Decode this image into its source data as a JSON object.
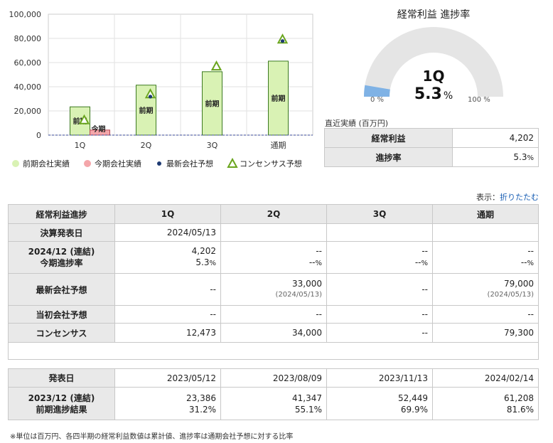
{
  "chart_data": {
    "type": "bar",
    "categories": [
      "1Q",
      "2Q",
      "3Q",
      "通期"
    ],
    "ylim": [
      0,
      100000
    ],
    "yticks": [
      "0",
      "20,000",
      "40,000",
      "60,000",
      "80,000",
      "100,000"
    ],
    "ytick_values": [
      0,
      20000,
      40000,
      60000,
      80000,
      100000
    ],
    "series": [
      {
        "name": "前期会社実績",
        "type": "bar",
        "color": "#d9f2b4",
        "stroke": "#3c7a20",
        "bar_label": "前期",
        "values": [
          23386,
          41347,
          52449,
          61208
        ]
      },
      {
        "name": "今期会社実績",
        "type": "bar",
        "color": "#f4a6aa",
        "stroke": "#b84b55",
        "bar_label": "今期",
        "values": [
          4202,
          null,
          null,
          null
        ]
      },
      {
        "name": "最新会社予想",
        "type": "dot",
        "color": "#1f3b73",
        "values": [
          null,
          33000,
          null,
          79000
        ]
      },
      {
        "name": "コンセンサス予想",
        "type": "triangle",
        "color": "#6aa51e",
        "values": [
          12473,
          34000,
          57000,
          79300
        ]
      }
    ],
    "grid": true
  },
  "gauge": {
    "title": "経常利益 進捗率",
    "quarter": "1Q",
    "value": "5.3",
    "unit": "%",
    "fraction": 0.053,
    "min_label": "0 %",
    "max_label": "100 %",
    "fill_color": "#7fb2e5",
    "track_color": "#e5e5e5"
  },
  "recent": {
    "caption": "直近実績 (百万円)",
    "rows": [
      {
        "label": "経常利益",
        "value": "4,202"
      },
      {
        "label": "進捗率",
        "value": "5.3",
        "unit": "%"
      }
    ]
  },
  "display": {
    "label": "表示：",
    "link": "折りたたむ"
  },
  "main_table": {
    "header": [
      "経常利益進捗",
      "1Q",
      "2Q",
      "3Q",
      "通期"
    ],
    "announce": {
      "label": "決算発表日",
      "values": [
        "2024/05/13",
        "",
        "",
        ""
      ]
    },
    "current": {
      "label1": "2024/12 (連結)",
      "label2": "今期進捗率",
      "values": [
        "4,202",
        "--",
        "--",
        "--"
      ],
      "pcts": [
        "5.3",
        "--",
        "--",
        "--"
      ],
      "pct_unit": "%"
    },
    "latest": {
      "label": "最新会社予想",
      "values": [
        "--",
        "33,000",
        "--",
        "79,000"
      ],
      "dates": [
        "",
        "(2024/05/13)",
        "",
        "(2024/05/13)"
      ]
    },
    "initial": {
      "label": "当初会社予想",
      "values": [
        "--",
        "--",
        "--",
        "--"
      ]
    },
    "consensus": {
      "label": "コンセンサス",
      "values": [
        "12,473",
        "34,000",
        "--",
        "79,300"
      ]
    }
  },
  "prev_table": {
    "announce": {
      "label": "発表日",
      "values": [
        "2023/05/12",
        "2023/08/09",
        "2023/11/13",
        "2024/02/14"
      ]
    },
    "result": {
      "label1": "2023/12 (連結)",
      "label2": "前期進捗結果",
      "values": [
        "23,386",
        "41,347",
        "52,449",
        "61,208"
      ],
      "pcts": [
        "31.2",
        "55.1",
        "69.9",
        "81.6"
      ],
      "pct_unit": "%"
    }
  },
  "footnote": "※単位は百万円、各四半期の経常利益数値は累計値、進捗率は通期会社予想に対する比率"
}
